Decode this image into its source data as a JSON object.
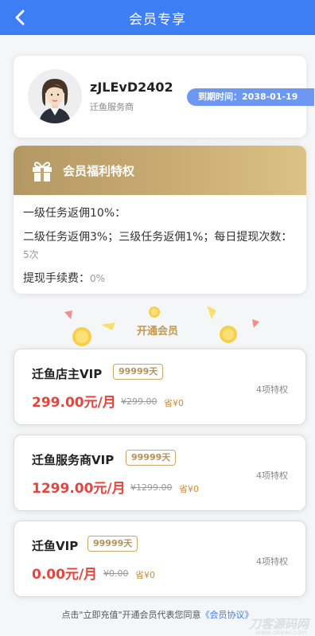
{
  "header": {
    "title": "会员专享"
  },
  "profile": {
    "username": "zJLEvD2402",
    "role": "迁鱼服务商",
    "expire_label": "到期时间：2038-01-19"
  },
  "benefits": {
    "title": "会员福利特权",
    "line1": "一级任务返佣10%：",
    "line2": "二级任务返佣3%；三级任务返佣1%；每日提现次数：",
    "line2_value": "5次",
    "line3": "提现手续费：",
    "line3_value": "0%"
  },
  "open_title": "开通会员",
  "plans": [
    {
      "name": "迁鱼店主VIP",
      "days": "99999天",
      "price": "299.00元/月",
      "original": "¥299.00",
      "save": "省¥0",
      "privileges": "4项特权"
    },
    {
      "name": "迁鱼服务商VIP",
      "days": "99999天",
      "price": "1299.00元/月",
      "original": "¥1299.00",
      "save": "省¥0",
      "privileges": "4项特权"
    },
    {
      "name": "迁鱼VIP",
      "days": "99999天",
      "price": "0.00元/月",
      "original": "¥0.00",
      "save": "省¥0",
      "privileges": "4项特权"
    }
  ],
  "footer": {
    "note": "点击\"立即充值\"开通会员代表您同意",
    "link": "《会员协议》"
  },
  "watermark": {
    "main": "刀客源码网",
    "sub": "www.dkewl.com"
  },
  "colors": {
    "primary": "#3d7ef5",
    "gold": "#c09a4e",
    "price": "#e8443c"
  }
}
